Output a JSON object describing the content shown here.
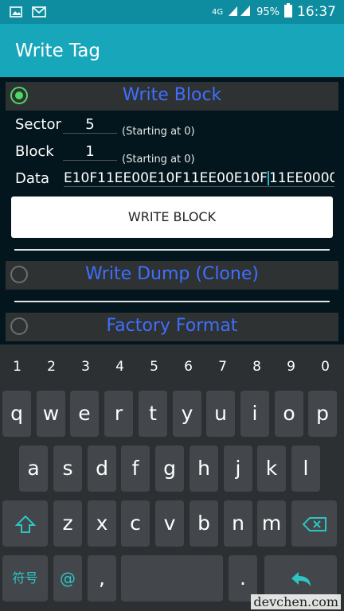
{
  "status": {
    "signal": "4G",
    "battery": "95%",
    "time": "16:37"
  },
  "appbar": {
    "title": "Write Tag"
  },
  "options": {
    "write_block": "Write Block",
    "write_dump": "Write Dump (Clone)",
    "factory_format": "Factory Format"
  },
  "form": {
    "sector_label": "Sector",
    "sector_value": "5",
    "block_label": "Block",
    "block_value": "1",
    "hint": "(Starting at 0)",
    "data_label": "Data",
    "data_value_a": "E10F11EE00E10F11EE00E10F",
    "data_value_b": "11EE0000",
    "button": "WRITE BLOCK"
  },
  "keyboard": {
    "numbers": [
      "1",
      "2",
      "3",
      "4",
      "5",
      "6",
      "7",
      "8",
      "9",
      "0"
    ],
    "row1": [
      "q",
      "w",
      "e",
      "r",
      "t",
      "y",
      "u",
      "i",
      "o",
      "p"
    ],
    "row2": [
      "a",
      "s",
      "d",
      "f",
      "g",
      "h",
      "j",
      "k",
      "l"
    ],
    "row3": [
      "z",
      "x",
      "c",
      "v",
      "b",
      "n",
      "m"
    ],
    "symbols_key": "符号",
    "at_key": "@",
    "comma_key": ",",
    "period_key": "."
  },
  "watermark": "devchen.com",
  "colors": {
    "appbar": "#18a7ba",
    "statusbar": "#0e8da0",
    "accent": "#3f6fff",
    "radio_on": "#4cd964"
  }
}
